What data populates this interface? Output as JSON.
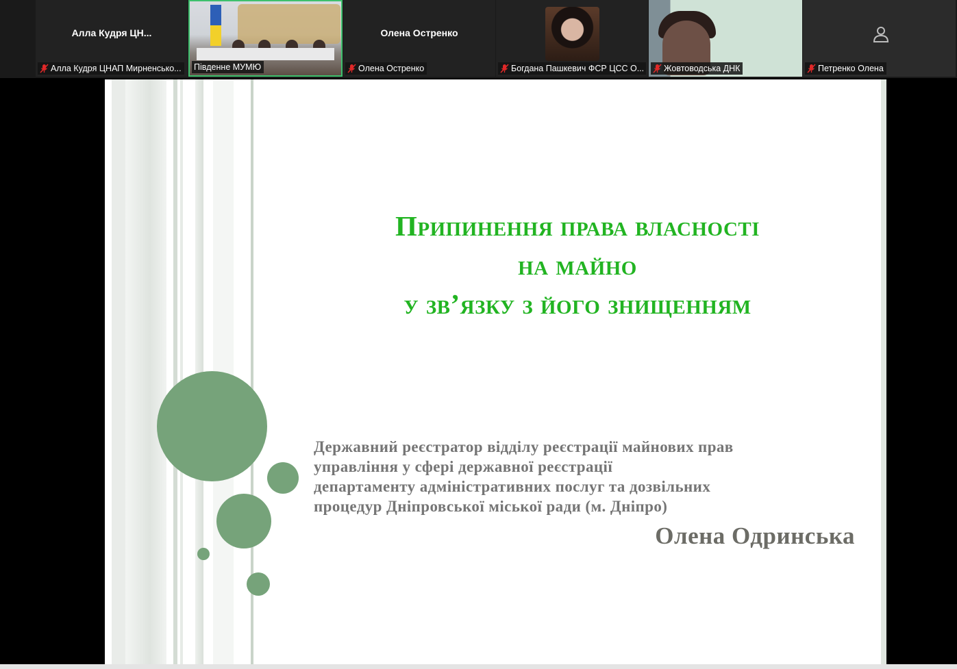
{
  "participants": [
    {
      "id": "p1",
      "display_name": "Алла  Кудря  ЦН...",
      "tag": "Алла Кудря ЦНАП Мирненсько...",
      "muted": true,
      "video": false
    },
    {
      "id": "p2",
      "display_name": "",
      "tag": "Південне МУМЮ",
      "muted": false,
      "video": true,
      "active": true
    },
    {
      "id": "p3",
      "display_name": "Олена Остренко",
      "tag": "Олена Остренко",
      "muted": true,
      "video": false
    },
    {
      "id": "p4",
      "display_name": "",
      "tag": "Богдана Пашкевич ФСР ЦСС О...",
      "muted": true,
      "video": false,
      "has_avatar": true
    },
    {
      "id": "p5",
      "display_name": "",
      "tag": "Жовтоводська ДНК",
      "muted": true,
      "video": true
    },
    {
      "id": "p6",
      "display_name": "",
      "tag": "Петренко Олена",
      "muted": true,
      "video": false
    }
  ],
  "slide": {
    "title_lines": [
      "Припинення права власності",
      "на майно",
      "у зв’язку з його знищенням"
    ],
    "author_position_lines": [
      "Державний реєстратор відділу реєстрації майнових прав",
      "управління у сфері державної реєстрації",
      "департаменту адміністративних послуг та дозвільних",
      "процедур Дніпровської міської ради (м. Дніпро)"
    ],
    "author_name": "Олена Одринська"
  },
  "colors": {
    "title_green": "#22b422",
    "circle_green": "#76a37a",
    "active_speaker_border": "#3ec06d",
    "muted_mic_red": "#e02828"
  },
  "icons": {
    "muted": "mic-muted-icon",
    "no_video": "avatar-placeholder-icon"
  }
}
